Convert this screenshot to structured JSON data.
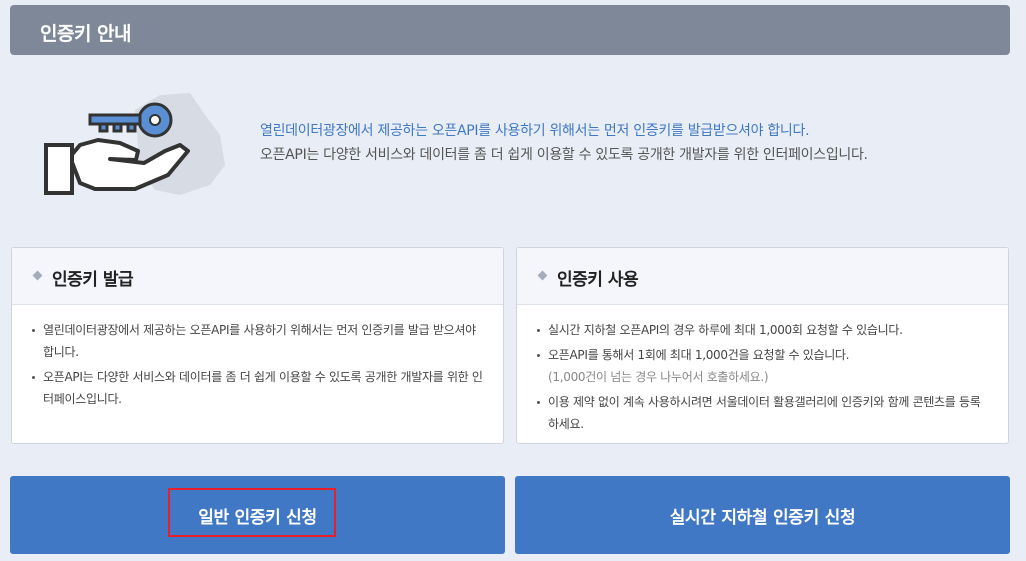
{
  "header": {
    "title": "인증키 안내"
  },
  "hero": {
    "icon": "key-in-hand-icon",
    "line1": "열린데이터광장에서 제공하는 오픈API를 사용하기 위해서는 먼저 인증키를 발급받으셔야 합니다.",
    "line2": "오픈API는 다양한 서비스와 데이터를 좀 더 쉽게 이용할 수 있도록 공개한 개발자를 위한 인터페이스입니다."
  },
  "issue_panel": {
    "title": "인증키 발급",
    "items": [
      {
        "text": "열린데이터광장에서 제공하는 오픈API를 사용하기 위해서는 먼저 인증키를 발급 받으셔야 합니다."
      },
      {
        "text": "오픈API는 다양한 서비스와 데이터를 좀 더 쉽게 이용할 수 있도록 공개한 개발자를 위한 인터페이스입니다."
      }
    ]
  },
  "usage_panel": {
    "title": "인증키 사용",
    "items": [
      {
        "text": "실시간 지하철 오픈API의 경우 하루에 최대 1,000회 요청할 수 있습니다."
      },
      {
        "text": "오픈API를 통해서 1회에 최대 1,000건을 요청할 수 있습니다.",
        "note": "(1,000건이 넘는 경우 나누어서 호출하세요.)"
      },
      {
        "text": "이용 제약 없이 계속 사용하시려면 서울데이터 활용갤러리에 인증키와 함께 콘텐츠를 등록하세요."
      }
    ]
  },
  "buttons": {
    "general": "일반 인증키 신청",
    "subway": "실시간 지하철 인증키 신청"
  },
  "colors": {
    "accent": "#4178c6",
    "header_bg": "#7e8899",
    "highlight": "#e8202a",
    "page_bg": "#e9edf5"
  }
}
